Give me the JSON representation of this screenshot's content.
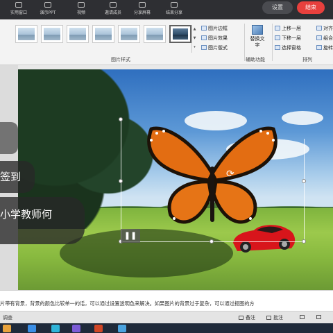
{
  "meeting_bar": {
    "items": [
      "实用窗口",
      "演示PPT",
      "视频",
      "邀请成员",
      "分享屏幕",
      "结束分享"
    ],
    "gray_button": "设置",
    "red_button": "结束"
  },
  "ribbon": {
    "picture_styles_label": "图片样式",
    "picture_border": "图片边框",
    "picture_effects": "图片效果",
    "picture_layout": "图片版式",
    "alt_text": "替换文字",
    "accessibility_label": "辅助功能",
    "bring_forward": "上移一层",
    "send_backward": "下移一层",
    "selection_pane": "选择窗格",
    "align": "对齐",
    "group": "组合",
    "rotate": "旋转",
    "arrange_label": "排列"
  },
  "overlay": {
    "sign_in": "签到",
    "teacher": "小学教师何"
  },
  "notes": {
    "text": "片带有背景，背景的颜色比较单一的话，可以通过设置透明色来解决。如果图片的背景过于复杂，可以通过抠图的方"
  },
  "status": {
    "left": "调查",
    "notes_btn": "备注",
    "comments_btn": "批注"
  },
  "colors": {
    "accent_red": "#e8403d",
    "ribbon_bg": "#f3f3f3"
  }
}
